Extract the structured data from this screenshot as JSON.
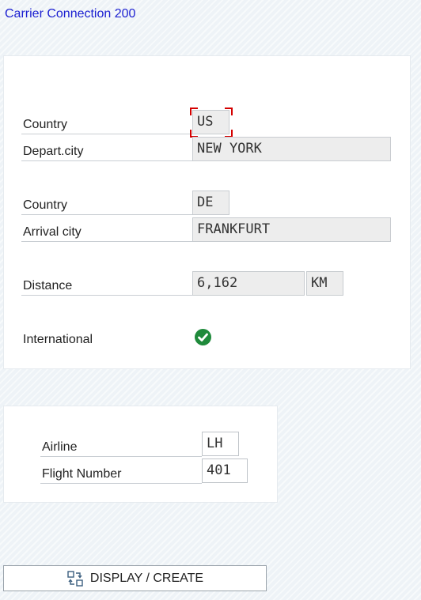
{
  "window": {
    "title": "Carrier Connection 200"
  },
  "departure": {
    "country_label": "Country",
    "country_value": "US",
    "city_label": "Depart.city",
    "city_value": "NEW YORK"
  },
  "arrival": {
    "country_label": "Country",
    "country_value": "DE",
    "city_label": "Arrival city",
    "city_value": "FRANKFURT"
  },
  "distance": {
    "label": "Distance",
    "value": "6,162",
    "unit": "KM"
  },
  "international": {
    "label": "International",
    "checked": true,
    "icon": "green-check-icon"
  },
  "flight": {
    "airline_label": "Airline",
    "airline_value": "LH",
    "number_label": "Flight Number",
    "number_value": "401"
  },
  "toolbar": {
    "display_create_label": "DISPLAY / CREATE",
    "display_create_icon": "display-create-icon"
  },
  "colors": {
    "title": "#1b1fd1",
    "focus": "#d40000",
    "check": "#1f8a3b"
  }
}
